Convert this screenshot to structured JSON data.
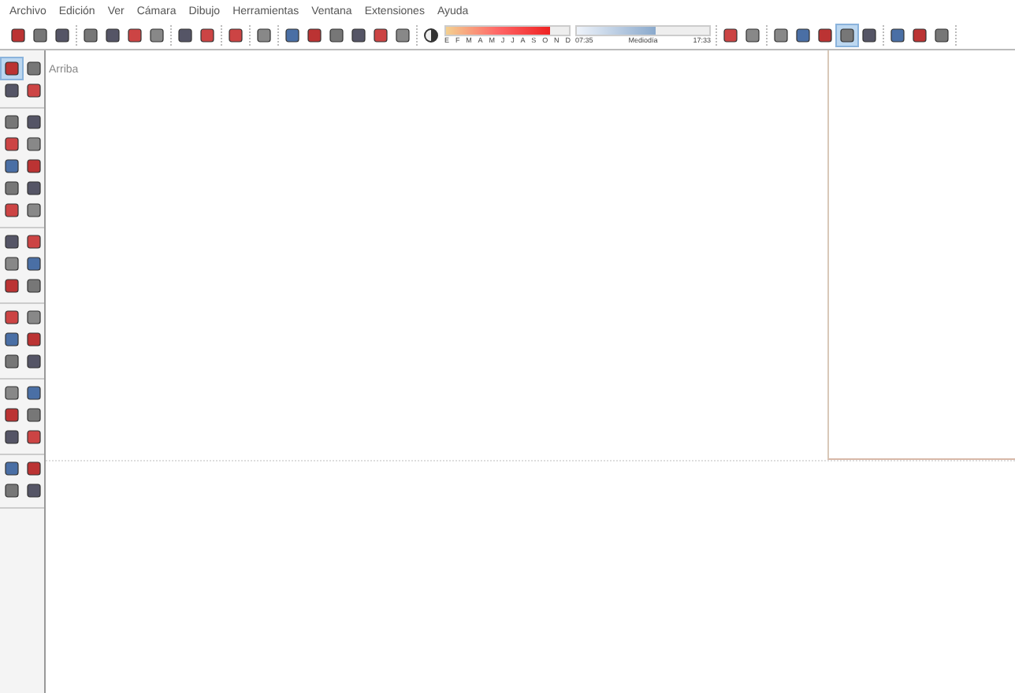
{
  "menu": [
    "Archivo",
    "Edición",
    "Ver",
    "Cámara",
    "Dibujo",
    "Herramientas",
    "Ventana",
    "Extensiones",
    "Ayuda"
  ],
  "toolbar": {
    "groups": [
      {
        "icons": [
          {
            "selected": false
          },
          {
            "selected": false
          },
          {
            "selected": false
          }
        ]
      },
      {
        "icons": [
          {
            "selected": false
          },
          {
            "selected": false
          },
          {
            "selected": false
          },
          {
            "selected": false
          }
        ]
      },
      {
        "icons": [
          {
            "selected": false
          },
          {
            "selected": false
          }
        ]
      },
      {
        "icons": [
          {
            "selected": false
          }
        ]
      },
      {
        "icons": [
          {
            "selected": false
          }
        ]
      },
      {
        "icons": [
          {
            "selected": false
          },
          {
            "selected": false
          },
          {
            "selected": false
          },
          {
            "selected": false
          },
          {
            "selected": false
          },
          {
            "selected": false
          }
        ]
      }
    ],
    "shadows": {
      "months": [
        "E",
        "F",
        "M",
        "A",
        "M",
        "J",
        "J",
        "A",
        "S",
        "O",
        "N",
        "D"
      ],
      "month_slider": {
        "level": 0.85
      },
      "time_start": "07:35",
      "time_mid": "Mediodía",
      "time_end": "17:33",
      "time_slider": {
        "level": 0.6
      }
    },
    "groups_after": [
      {
        "icons": [
          {
            "selected": false
          },
          {
            "selected": false
          }
        ]
      },
      {
        "icons": [
          {
            "selected": false
          },
          {
            "selected": false
          },
          {
            "selected": false
          },
          {
            "selected": true
          },
          {
            "selected": false
          }
        ]
      },
      {
        "icons": [
          {
            "selected": false
          },
          {
            "selected": false
          },
          {
            "selected": false
          }
        ]
      }
    ]
  },
  "palette": [
    {
      "icons": [
        {
          "selected": true
        },
        {
          "selected": false
        },
        {
          "selected": false
        },
        {
          "selected": false
        }
      ]
    },
    {
      "icons": [
        {
          "selected": false
        },
        {
          "selected": false
        },
        {
          "selected": false
        },
        {
          "selected": false
        },
        {
          "selected": false
        },
        {
          "selected": false
        },
        {
          "selected": false
        },
        {
          "selected": false
        },
        {
          "selected": false
        },
        {
          "selected": false
        }
      ]
    },
    {
      "icons": [
        {
          "selected": false
        },
        {
          "selected": false
        },
        {
          "selected": false
        },
        {
          "selected": false
        },
        {
          "selected": false
        },
        {
          "selected": false
        }
      ]
    },
    {
      "icons": [
        {
          "selected": false
        },
        {
          "selected": false
        },
        {
          "selected": false
        },
        {
          "selected": false
        },
        {
          "selected": false
        },
        {
          "selected": false
        }
      ]
    },
    {
      "icons": [
        {
          "selected": false
        },
        {
          "selected": false
        },
        {
          "selected": false
        },
        {
          "selected": false
        },
        {
          "selected": false
        },
        {
          "selected": false
        }
      ]
    },
    {
      "icons": [
        {
          "selected": false
        },
        {
          "selected": false
        },
        {
          "selected": false
        },
        {
          "selected": false
        }
      ]
    }
  ],
  "viewport": {
    "view_name": "Arriba"
  }
}
